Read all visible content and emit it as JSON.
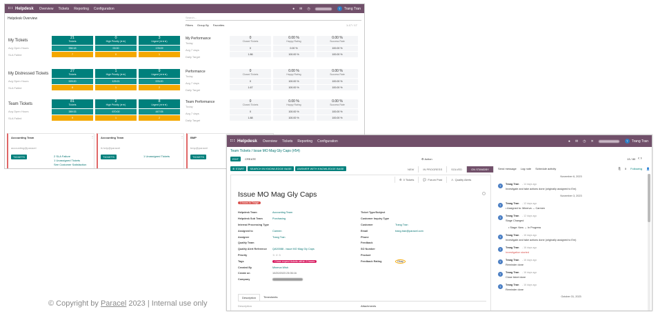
{
  "overview": {
    "app": "Helpdesk",
    "menu": [
      "Overview",
      "Tickets",
      "Reporting",
      "Configuration"
    ],
    "username": "Trang Tran",
    "page_title": "Helpdesk Overview",
    "search_placeholder": "Search...",
    "filters": [
      "Filters",
      "Group By",
      "Favorites"
    ],
    "pager": "1-17 / 17",
    "rows": [
      {
        "title": "My Tickets",
        "sub1": "Avg Open Hours",
        "sub2": "SLA Failed",
        "cards": [
          {
            "n": "21",
            "t": "Tickets",
            "a": "Hours",
            "av": "956:18"
          },
          {
            "n": "0",
            "t": "High Priority (★★)",
            "a": "Hours",
            "av": "00:00"
          },
          {
            "n": "3",
            "t": "Urgent (★★★)",
            "a": "Hours",
            "av": "178:09"
          }
        ],
        "fail": [
          "7",
          "0",
          "1"
        ]
      },
      {
        "title": "My Distressed Tickets",
        "sub1": "Avg Open Hours",
        "sub2": "SLA Failed",
        "cards": [
          {
            "n": "27",
            "t": "Tickets",
            "a": "Hours",
            "av": "929:20"
          },
          {
            "n": "1",
            "t": "High Priority (★★)",
            "a": "Hours",
            "av": "129:21"
          },
          {
            "n": "9",
            "t": "Urgent (★★★)",
            "a": "Hours",
            "av": "576:20"
          }
        ],
        "fail": [
          "8",
          "1",
          "2"
        ]
      },
      {
        "title": "Team Tickets",
        "sub1": "Avg Open Hours",
        "sub2": "SLA Failed",
        "cards": [
          {
            "n": "81",
            "t": "Tickets",
            "a": "Hours",
            "av": "389:33"
          },
          {
            "n": "2",
            "t": "High Priority (★★)",
            "a": "Hours",
            "av": "670:00"
          },
          {
            "n": "8",
            "t": "Urgent (★★★)",
            "a": "Hours",
            "av": "447:05"
          }
        ],
        "fail": [
          "9",
          "1",
          "2"
        ]
      }
    ],
    "perf": [
      {
        "title": "My Performance",
        "rows": [
          "Today",
          "Avg 7 days",
          "Daily Target"
        ],
        "cols": [
          {
            "h": "0",
            "s": "Closed Tickets",
            "v": [
              "0",
              "1.86"
            ]
          },
          {
            "h": "0.00 %",
            "s": "Happy Rating",
            "v": [
              "0.00 %",
              "100.00 %"
            ]
          },
          {
            "h": "0.00 %",
            "s": "Success Rate",
            "v": [
              "100.00 %",
              "100.00 %"
            ]
          }
        ]
      },
      {
        "title": "Performance",
        "rows": [
          "Today",
          "Avg 7 days",
          "Daily Target"
        ],
        "cols": [
          {
            "h": "0",
            "s": "Closed Tickets",
            "v": [
              "0",
              "1.67"
            ]
          },
          {
            "h": "0.00 %",
            "s": "Happy Rating",
            "v": [
              "100.00 %",
              "100.00 %"
            ]
          },
          {
            "h": "0.00 %",
            "s": "Success Rate",
            "v": [
              "100.00 %",
              "100.00 %"
            ]
          }
        ]
      },
      {
        "title": "Team Performance",
        "rows": [
          "Today",
          "Avg 7 days",
          "Daily Target"
        ],
        "cols": [
          {
            "h": "0",
            "s": "Closed Tickets",
            "v": [
              "0",
              "1.88"
            ]
          },
          {
            "h": "0.00 %",
            "s": "Happy Rating",
            "v": [
              "100.00 %",
              "100.00 %"
            ]
          },
          {
            "h": "0.00 %",
            "s": "Success Rate",
            "v": [
              "100.00 %",
              "100.00 %"
            ]
          }
        ]
      }
    ],
    "teams": [
      {
        "name": "Accounting Team",
        "email": "accounting@paracel",
        "button": "TICKETS",
        "links": [
          "2 SLA Failure",
          "1 Unassigned Tickets",
          "See Customer Satisfaction"
        ]
      },
      {
        "name": "Accounting Team",
        "email": "it-help@paracel",
        "button": "TICKETS",
        "links": [
          "1 Unassigned Tickets"
        ]
      },
      {
        "name": "BMP",
        "email": "bmp@paracel",
        "button": "TICKETS",
        "links": []
      }
    ]
  },
  "ticket": {
    "app": "Helpdesk",
    "menu": [
      "Overview",
      "Tickets",
      "Reporting",
      "Configuration"
    ],
    "username": "Trang Tran",
    "breadcrumb": "Team Tickets / Issue MO Mag Gly Caps (#54)",
    "edit": "EDIT",
    "create": "CREATE",
    "action": "⚙ Action",
    "pager": "13 / 80",
    "actions": [
      "⊕ START",
      "SEARCH IN KNOWLEDGE BASE",
      "ANSWER WITH KNOWLEDGE BASE"
    ],
    "stages": [
      "NEW",
      "IN PROGRESS",
      "SOLVED",
      "ON STANDBY",
      "MORE ▾"
    ],
    "smart": [
      "0 Tickets",
      "Forum Post",
      "Quality Alerts"
    ],
    "title": "Issue MO Mag Gly Caps",
    "tag_top": "3 hours to Triage",
    "left": [
      {
        "l": "Helpdesk Team",
        "v": "Accounting Team"
      },
      {
        "l": "Helpdesk Sub Team",
        "v": "Purchasing"
      },
      {
        "l": "Internal Processing Type",
        "v": ""
      },
      {
        "l": "Assigned to",
        "v": "Carmen"
      },
      {
        "l": "Assigner",
        "v": "Trang Tran"
      },
      {
        "l": "Quality Team",
        "v": ""
      },
      {
        "l": "Quality Alert Reference",
        "v": "QA00088 - Issue MO Mag Gly Caps"
      },
      {
        "l": "Priority",
        "v": "☆ ☆ ☆"
      },
      {
        "l": "Tags",
        "v": "Close expect tickets within 3 hours"
      },
      {
        "l": "Created By",
        "v": "Minerva Wish"
      },
      {
        "l": "Create on",
        "v": "10/20/2023 23:06:16"
      },
      {
        "l": "Company",
        "v": ""
      }
    ],
    "right": [
      {
        "l": "Ticket Type/Subject",
        "v": ""
      },
      {
        "l": "Customer Inquiry Type",
        "v": ""
      },
      {
        "l": "Customer",
        "v": "Trang Tran"
      },
      {
        "l": "Email",
        "v": "trang.tran@paracel.com"
      },
      {
        "l": "Phone",
        "v": ""
      },
      {
        "l": "Feedback",
        "v": ""
      },
      {
        "l": "SO Number",
        "v": ""
      },
      {
        "l": "Product",
        "v": ""
      },
      {
        "l": "Feedback Rating",
        "v": "Okay"
      }
    ],
    "tabs": [
      "Description",
      "Timesheets"
    ],
    "desc_label": "Description",
    "attach_label": "Attachments",
    "chatter_top": [
      "Send message",
      "Log note",
      "Schedule activity"
    ],
    "followers": "0",
    "following": "Following",
    "dates": [
      "November 6, 2023",
      "November 3, 2023",
      "October 31, 2023"
    ],
    "messages": [
      {
        "who": "Trang Tran",
        "when": "- 14 days ago",
        "txt": "Investigate and take actions done (originally assigned to Em)"
      },
      {
        "who": "Trang Tran",
        "when": "- 12 days ago",
        "txt": "• Assigned to: Minerva → Carmen"
      },
      {
        "who": "Trang Tran",
        "when": "- 12 days ago",
        "txt": "Stage Changed"
      },
      {
        "who": "",
        "when": "",
        "txt": "• Stage: New → In Progress"
      },
      {
        "who": "Trang Tran",
        "when": "- 16 days ago",
        "txt": "Investigate and take actions done (originally assigned to Em)"
      },
      {
        "who": "Trang Tran",
        "when": "- 16 days ago",
        "txt": "Investigation started"
      },
      {
        "who": "Trang Tran",
        "when": "- 16 days ago",
        "txt": "Reminder done"
      },
      {
        "who": "Trang Tran",
        "when": "- 16 days ago",
        "txt": "Close ticket done"
      },
      {
        "who": "Trang Tran",
        "when": "- 16 days ago",
        "txt": "Reminder done"
      }
    ]
  },
  "footer": {
    "prefix": "© Copyright by ",
    "link": "Paracel",
    "suffix": " 2023 | Internal use only"
  },
  "colors": {
    "topbar": "#71506a",
    "teal": "#00807c",
    "orange": "#f4a800",
    "danger": "#d9534f"
  }
}
